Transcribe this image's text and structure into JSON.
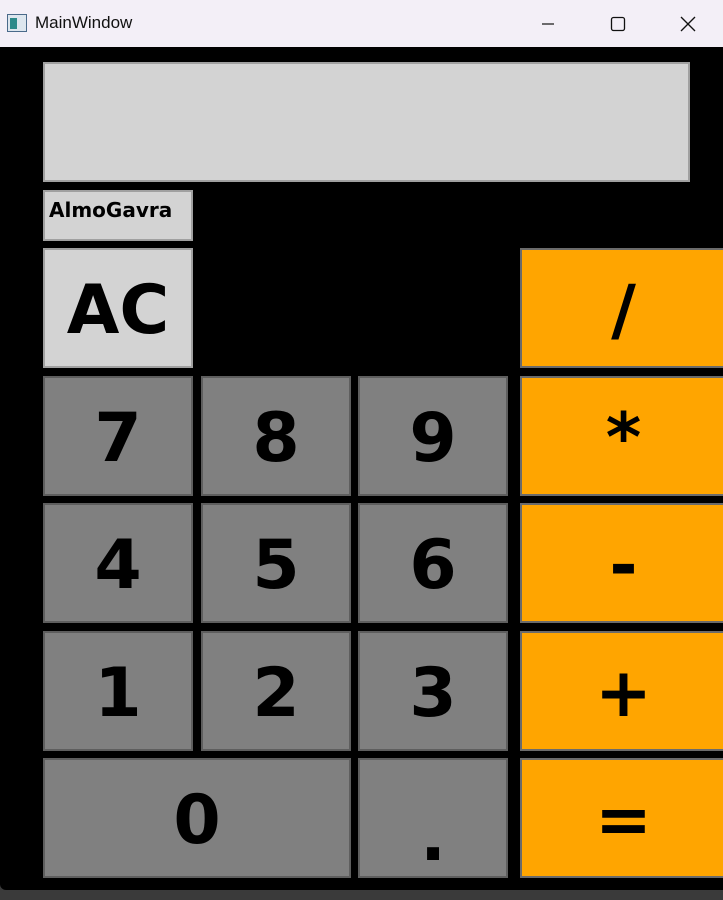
{
  "window": {
    "title": "MainWindow",
    "controls": {
      "minimize_icon": "minimize-icon",
      "maximize_icon": "maximize-icon",
      "close_icon": "close-icon"
    }
  },
  "calculator": {
    "display_value": "",
    "name_label": "AlmoGavra",
    "keys": {
      "ac": "AC",
      "divide": "/",
      "multiply": "*",
      "subtract": "-",
      "add": "+",
      "equals": "=",
      "d7": "7",
      "d8": "8",
      "d9": "9",
      "d4": "4",
      "d5": "5",
      "d6": "6",
      "d1": "1",
      "d2": "2",
      "d3": "3",
      "d0": "0",
      "dot": "."
    }
  },
  "colors": {
    "background": "#000000",
    "number_key": "#808080",
    "operator_key": "#ffa500",
    "display": "#d3d3d3",
    "titlebar": "#f3eff7"
  }
}
